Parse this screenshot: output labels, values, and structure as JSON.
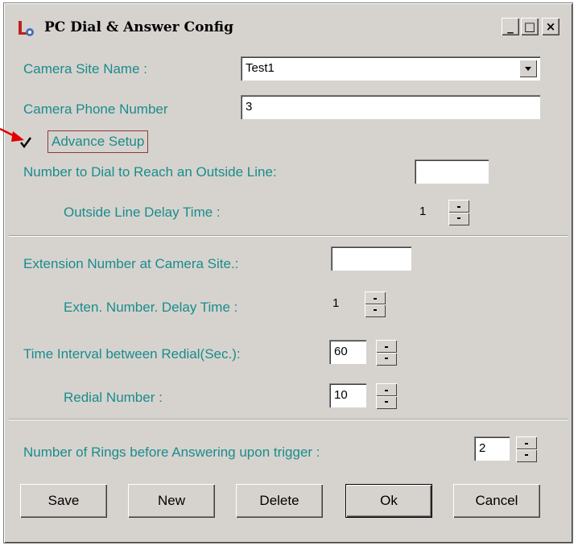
{
  "window": {
    "title": "PC Dial & Answer Config",
    "controls": [
      "_",
      "□",
      "×"
    ]
  },
  "colors": {
    "label": "#1a8c8c",
    "face": "#d6d3ce",
    "arrow": "#e00000"
  },
  "form": {
    "site_name_label": "Camera Site Name :",
    "site_name_value": "Test1",
    "phone_label": "Camera Phone Number",
    "phone_value": "3",
    "advance_label": "Advance Setup",
    "advance_checked": true,
    "outside_line_label": "Number to Dial to Reach an Outside Line:",
    "outside_line_value": "",
    "outside_delay_label": "Outside Line Delay Time :",
    "outside_delay_value": "1",
    "extension_label": "Extension Number at Camera Site.:",
    "extension_value": "",
    "exten_delay_label": "Exten. Number. Delay Time :",
    "exten_delay_value": "1",
    "redial_interval_label": "Time Interval between Redial(Sec.):",
    "redial_interval_value": "60",
    "redial_number_label": "Redial Number :",
    "redial_number_value": "10",
    "rings_label": "Number of Rings before Answering upon trigger :",
    "rings_value": "2"
  },
  "buttons": {
    "save": "Save",
    "new": "New",
    "delete": "Delete",
    "ok": "Ok",
    "cancel": "Cancel"
  },
  "icons": [
    "app-icon",
    "minimize-icon",
    "maximize-icon",
    "close-icon",
    "red-arrow-icon"
  ]
}
